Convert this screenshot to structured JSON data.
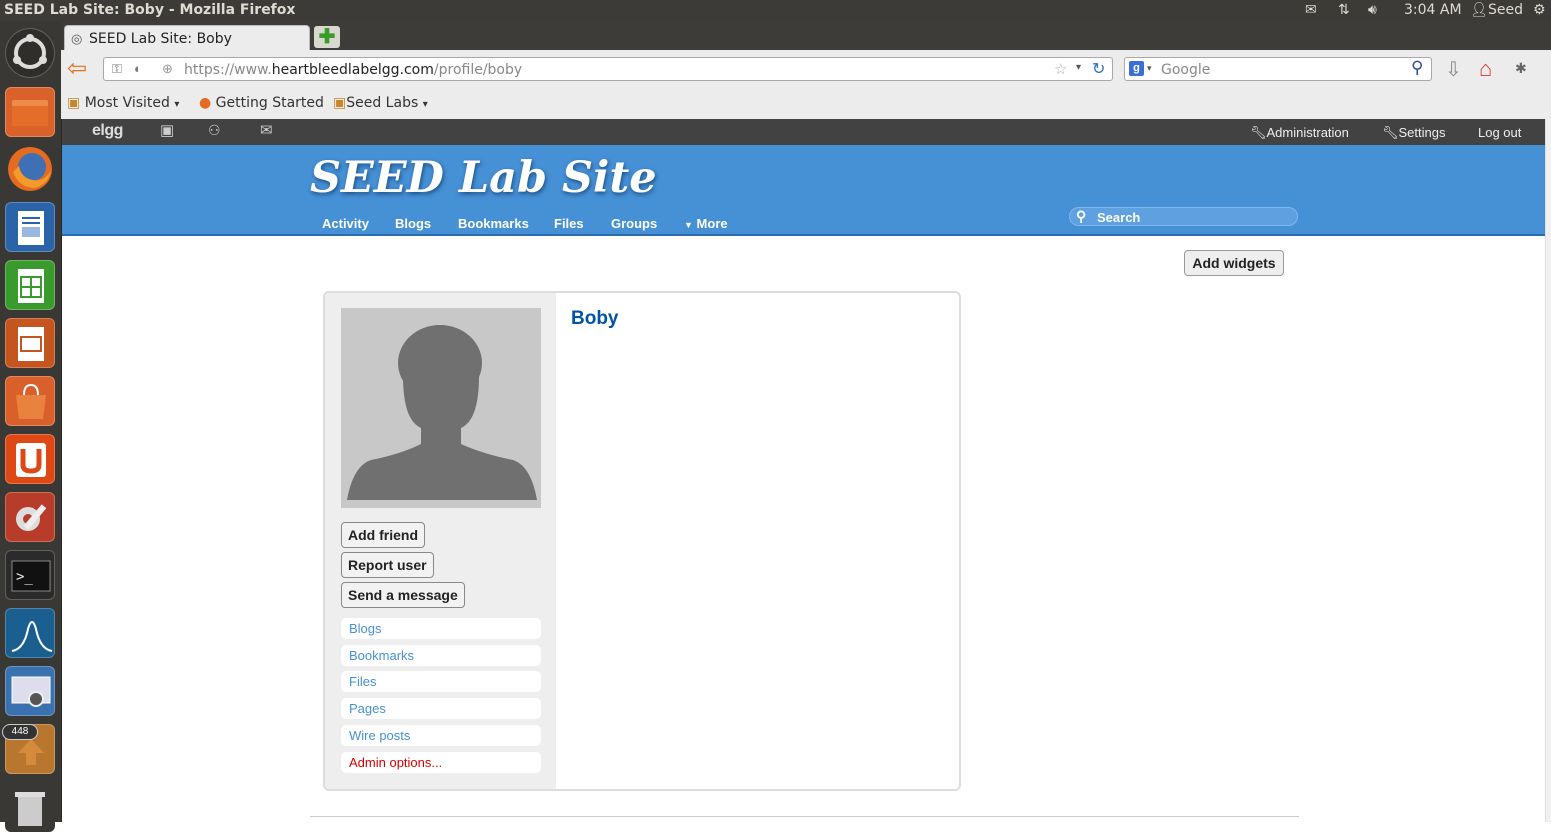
{
  "os_panel": {
    "window_title": "SEED Lab Site: Boby - Mozilla Firefox",
    "time": "3:04 AM",
    "user": "Seed"
  },
  "launcher": {
    "badge_count": "448",
    "apps": [
      "ubuntu-dash-icon",
      "files-icon",
      "firefox-icon",
      "writer-icon",
      "calc-icon",
      "impress-icon",
      "software-center-icon",
      "ubuntu-one-icon",
      "system-settings-icon",
      "terminal-icon",
      "wireshark-icon",
      "screenshot-icon",
      "update-manager-icon",
      "trash-icon"
    ]
  },
  "browser": {
    "tab_title": "SEED Lab Site: Boby",
    "url_prefix": "https://www.",
    "url_domain": "heartbleedlabelgg.com",
    "url_path": "/profile/boby",
    "search_placeholder": "Google",
    "bookmarks": [
      {
        "label": "Most Visited"
      },
      {
        "label": "Getting Started"
      },
      {
        "label": "Seed Labs"
      }
    ]
  },
  "elgg_topbar": {
    "logo": "elgg",
    "admin_label": "Administration",
    "settings_label": "Settings",
    "logout_label": "Log out"
  },
  "header": {
    "site_name": "SEED Lab Site",
    "menu": [
      "Activity",
      "Blogs",
      "Bookmarks",
      "Files",
      "Groups"
    ],
    "more_label": "More",
    "search_placeholder": "Search"
  },
  "content": {
    "add_widgets_label": "Add widgets",
    "profile_name": "Boby",
    "actions": [
      "Add friend",
      "Report user",
      "Send a message"
    ],
    "links": [
      "Blogs",
      "Bookmarks",
      "Files",
      "Pages",
      "Wire posts"
    ],
    "admin_options": "Admin options..."
  },
  "colors": {
    "header_blue": "#4690d6",
    "link_blue": "#4690d6",
    "name_blue": "#0054a7",
    "admin_red": "#d40000"
  }
}
